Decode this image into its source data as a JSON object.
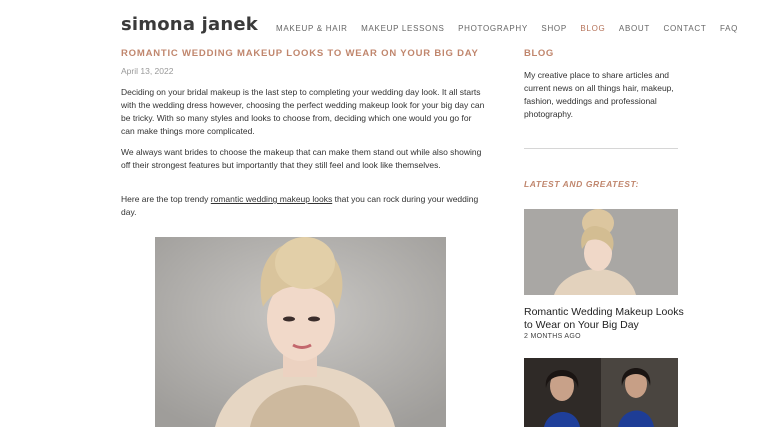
{
  "site": {
    "logo": "simona janek"
  },
  "nav": {
    "items": [
      "MAKEUP & HAIR",
      "MAKEUP LESSONS",
      "PHOTOGRAPHY",
      "SHOP",
      "BLOG",
      "ABOUT",
      "CONTACT",
      "FAQ"
    ],
    "active": "BLOG"
  },
  "post": {
    "title": "ROMANTIC WEDDING MAKEUP LOOKS TO WEAR ON YOUR BIG DAY",
    "date": "April 13, 2022",
    "p1": "Deciding  on your bridal makeup is the last step to completing your wedding day look. It all starts with the wedding dress however, choosing the perfect wedding makeup look for your big day can be tricky. With so many styles and looks to choose from, deciding which one would you go for can make things more complicated.",
    "p2": "We always want brides to choose the makeup that can make them stand out while also showing off their strongest features but importantly that they still feel and look like themselves.",
    "p3_before": "Here are the top trendy ",
    "p3_link": "romantic wedding makeup looks",
    "p3_after": " that you can rock during your wedding day."
  },
  "sidebar": {
    "heading": "BLOG",
    "description": "My creative place to share articles and current news on all things hair, makeup, fashion, weddings and professional photography.",
    "latest_heading": "LATEST AND GREATEST:",
    "posts": [
      {
        "title": "Romantic Wedding Makeup Looks to Wear on Your Big Day",
        "meta": "2 MONTHS AGO"
      }
    ]
  },
  "colors": {
    "accent": "#c0866d",
    "nav_active": "#b5735a",
    "text": "#333333"
  }
}
